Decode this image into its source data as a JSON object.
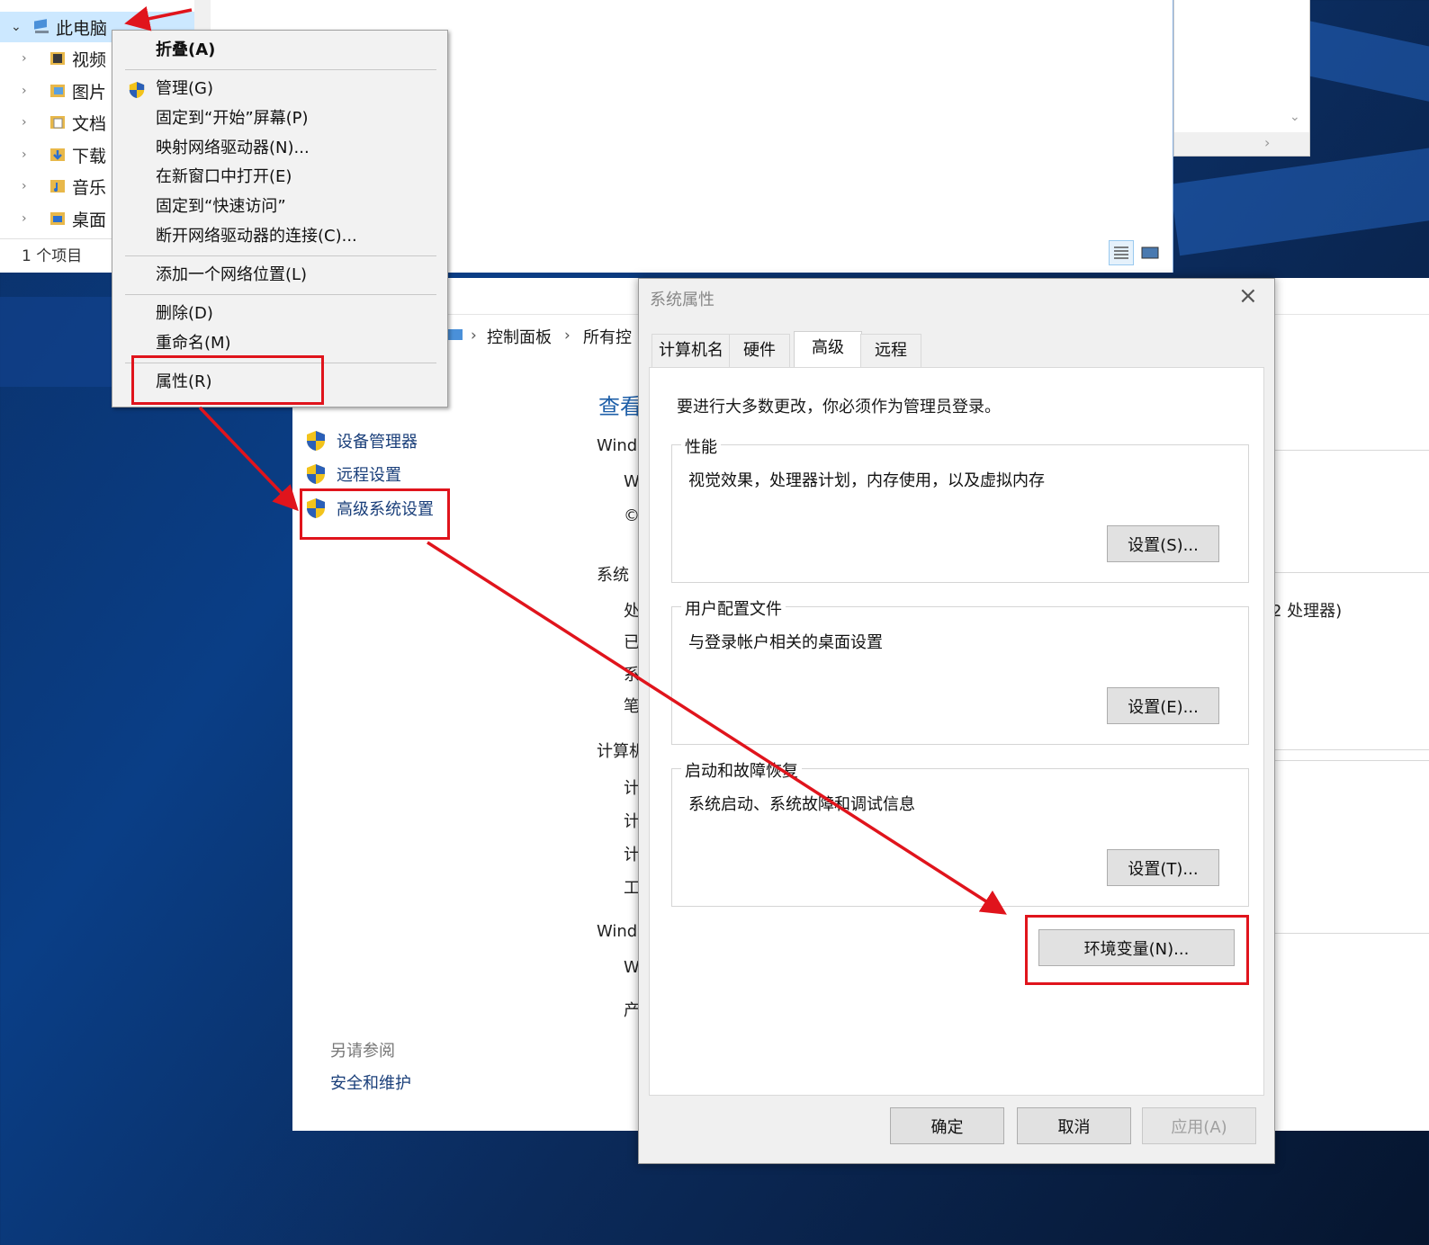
{
  "explorer": {
    "tree": [
      {
        "label": "此电脑",
        "icon": "computer-icon",
        "expanded": true,
        "selected": true
      },
      {
        "label": "视频",
        "icon": "video-folder-icon"
      },
      {
        "label": "图片",
        "icon": "pictures-folder-icon"
      },
      {
        "label": "文档",
        "icon": "documents-folder-icon"
      },
      {
        "label": "下载",
        "icon": "downloads-folder-icon"
      },
      {
        "label": "音乐",
        "icon": "music-folder-icon"
      },
      {
        "label": "桌面",
        "icon": "desktop-folder-icon"
      }
    ],
    "status": "1 个项目"
  },
  "context_menu": {
    "items": [
      {
        "label": "折叠(A)",
        "bold": true
      },
      {
        "label": "管理(G)",
        "icon": "shield-icon"
      },
      {
        "label": "固定到“开始”屏幕(P)"
      },
      {
        "label": "映射网络驱动器(N)..."
      },
      {
        "label": "在新窗口中打开(E)"
      },
      {
        "label": "固定到“快速访问”"
      },
      {
        "label": "断开网络驱动器的连接(C)..."
      },
      {
        "label": "添加一个网络位置(L)"
      },
      {
        "label": "删除(D)"
      },
      {
        "label": "重命名(M)"
      },
      {
        "label": "属性(R)"
      }
    ]
  },
  "control_panel": {
    "breadcrumb": [
      "控制面板",
      "所有控"
    ],
    "links": [
      "设备管理器",
      "远程设置",
      "高级系统设置"
    ],
    "see_also_title": "另请参阅",
    "see_also_link": "安全和维护",
    "heading_partial": "查看",
    "partial_texts": [
      "Windo",
      "W",
      "©",
      "系统",
      "处",
      "已",
      "系",
      "笔",
      "计算机",
      "计",
      "计",
      "计",
      "工",
      "Windo",
      "W",
      "产"
    ],
    "processor_tail": "2 处理器)"
  },
  "system_properties": {
    "title": "系统属性",
    "tabs": [
      "计算机名",
      "硬件",
      "高级",
      "远程"
    ],
    "active_tab": "高级",
    "admin_note": "要进行大多数更改，你必须作为管理员登录。",
    "groups": [
      {
        "title": "性能",
        "desc": "视觉效果，处理器计划，内存使用，以及虚拟内存",
        "button": "设置(S)..."
      },
      {
        "title": "用户配置文件",
        "desc": "与登录帐户相关的桌面设置",
        "button": "设置(E)..."
      },
      {
        "title": "启动和故障恢复",
        "desc": "系统启动、系统故障和调试信息",
        "button": "设置(T)..."
      }
    ],
    "env_button": "环境变量(N)...",
    "ok": "确定",
    "cancel": "取消",
    "apply": "应用(A)"
  },
  "colors": {
    "annotation_red": "#e0141c",
    "selection_blue": "#cce8ff",
    "link_blue": "#1a3f7a"
  }
}
